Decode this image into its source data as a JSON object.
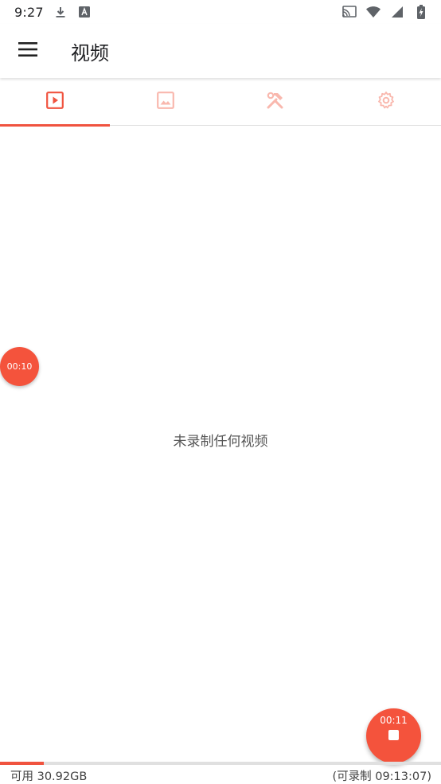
{
  "status_bar": {
    "time": "9:27",
    "icons_left": [
      "download-icon",
      "a-badge-icon"
    ],
    "icons_right": [
      "cast-icon",
      "wifi-icon",
      "signal-icon",
      "battery-charging-icon"
    ]
  },
  "app_bar": {
    "title": "视频",
    "menu_icon": "hamburger-menu-icon"
  },
  "tabs": [
    {
      "icon": "video-play-icon",
      "selected": true
    },
    {
      "icon": "image-icon",
      "selected": false
    },
    {
      "icon": "tools-icon",
      "selected": false
    },
    {
      "icon": "settings-gear-icon",
      "selected": false
    }
  ],
  "main": {
    "empty_message": "未录制任何视频"
  },
  "floating_bubble": {
    "timer": "00:10"
  },
  "fab": {
    "timer": "00:11",
    "icon": "stop-icon"
  },
  "storage": {
    "available": "可用 30.92GB",
    "record_time": "(可录制 09:13:07)",
    "used_fraction": 0.1
  },
  "colors": {
    "accent": "#f4533c",
    "tab_inactive": "#f9b8ae",
    "text": "#212121"
  }
}
